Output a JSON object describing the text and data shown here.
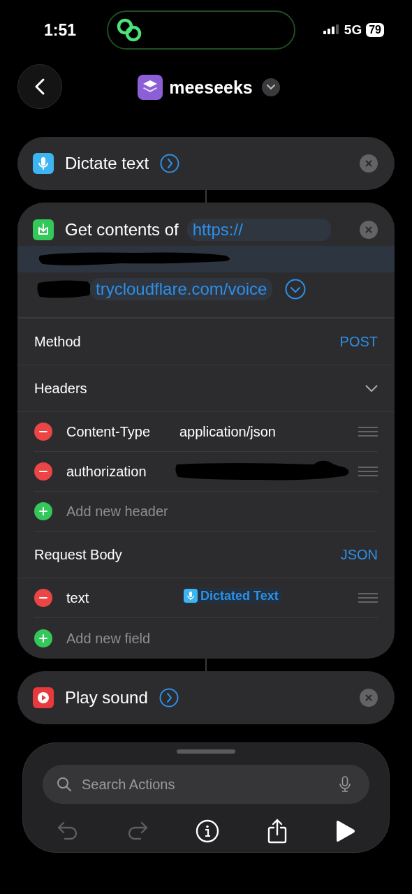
{
  "status_bar": {
    "time": "1:51",
    "network": "5G",
    "battery": "79"
  },
  "header": {
    "title": "meeseeks"
  },
  "actions": [
    {
      "kind": "dictate",
      "title": "Dictate text",
      "color": "#3db5f2"
    },
    {
      "kind": "request",
      "title": "Get contents of",
      "color": "#34c759",
      "url_start": "https://",
      "url_end": "trycloudflare.com/voice",
      "method_label": "Method",
      "method": "POST",
      "headers_label": "Headers",
      "expanded": true,
      "headers": [
        {
          "key": "Content-Type",
          "value": "application/json",
          "redacted": false
        },
        {
          "key": "authorization",
          "redacted": true
        }
      ],
      "add_header": "Add new header",
      "body_label": "Request Body",
      "body_type": "JSON",
      "fields": [
        {
          "key": "text",
          "variable": "Dictated Text"
        }
      ],
      "add_field": "Add new field"
    },
    {
      "kind": "sound",
      "title": "Play sound",
      "color": "#e8393c"
    }
  ],
  "search": {
    "placeholder": "Search Actions"
  },
  "toolbar": {
    "undo_disabled": true,
    "redo_disabled": true
  }
}
